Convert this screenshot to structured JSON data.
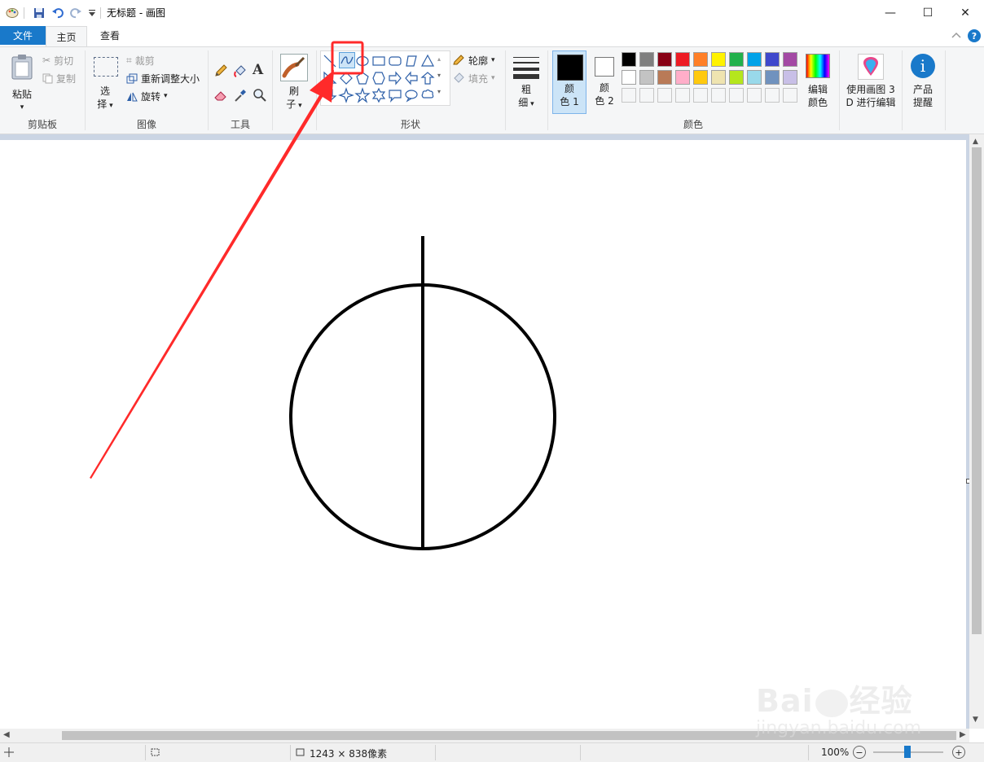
{
  "window": {
    "title": "无标题 - 画图",
    "minimize_glyph": "—",
    "maximize_glyph": "☐",
    "close_glyph": "✕"
  },
  "tabs": {
    "file": "文件",
    "home": "主页",
    "view": "查看"
  },
  "ribbon": {
    "clipboard": {
      "paste": "粘贴",
      "cut": "剪切",
      "copy": "复制",
      "label": "剪贴板"
    },
    "image": {
      "select_top": "选",
      "select_bottom": "择",
      "crop": "裁剪",
      "resize": "重新调整大小",
      "rotate": "旋转",
      "label": "图像"
    },
    "tools": {
      "label": "工具"
    },
    "brushes": {
      "top": "刷",
      "bottom": "子",
      "label": ""
    },
    "shapes": {
      "outline": "轮廓",
      "fill": "填充",
      "label": "形状"
    },
    "size": {
      "top": "粗",
      "bottom": "细"
    },
    "colors": {
      "color1_top": "颜",
      "color1_bottom": "色 1",
      "color2_top": "颜",
      "color2_bottom": "色 2",
      "edit_top": "编辑",
      "edit_bottom": "颜色",
      "label": "颜色",
      "palette_row1": [
        "#000000",
        "#7f7f7f",
        "#880015",
        "#ed1c24",
        "#ff7f27",
        "#fff200",
        "#22b14c",
        "#00a2e8",
        "#3f48cc",
        "#a349a4"
      ],
      "palette_row2": [
        "#ffffff",
        "#c3c3c3",
        "#b97a57",
        "#ffaec9",
        "#ffc90e",
        "#efe4b0",
        "#b5e61d",
        "#99d9ea",
        "#7092be",
        "#c8bfe7"
      ],
      "accent_selected": "#cce4f7",
      "primary": "#000000",
      "secondary": "#ffffff"
    },
    "paint3d": {
      "top": "使用画图 3",
      "bottom": "D 进行编辑"
    },
    "product": {
      "top": "产品",
      "bottom": "提醒"
    }
  },
  "statusbar": {
    "dimensions": "1243 × 838像素",
    "zoom": "100%",
    "zoom_minus": "−",
    "zoom_plus": "+"
  },
  "annotation": {
    "highlight_color": "#ff2a2a"
  },
  "watermark": {
    "brand": "Bai",
    "brand_tail": "经验",
    "url": "jingyan.baidu.com"
  }
}
